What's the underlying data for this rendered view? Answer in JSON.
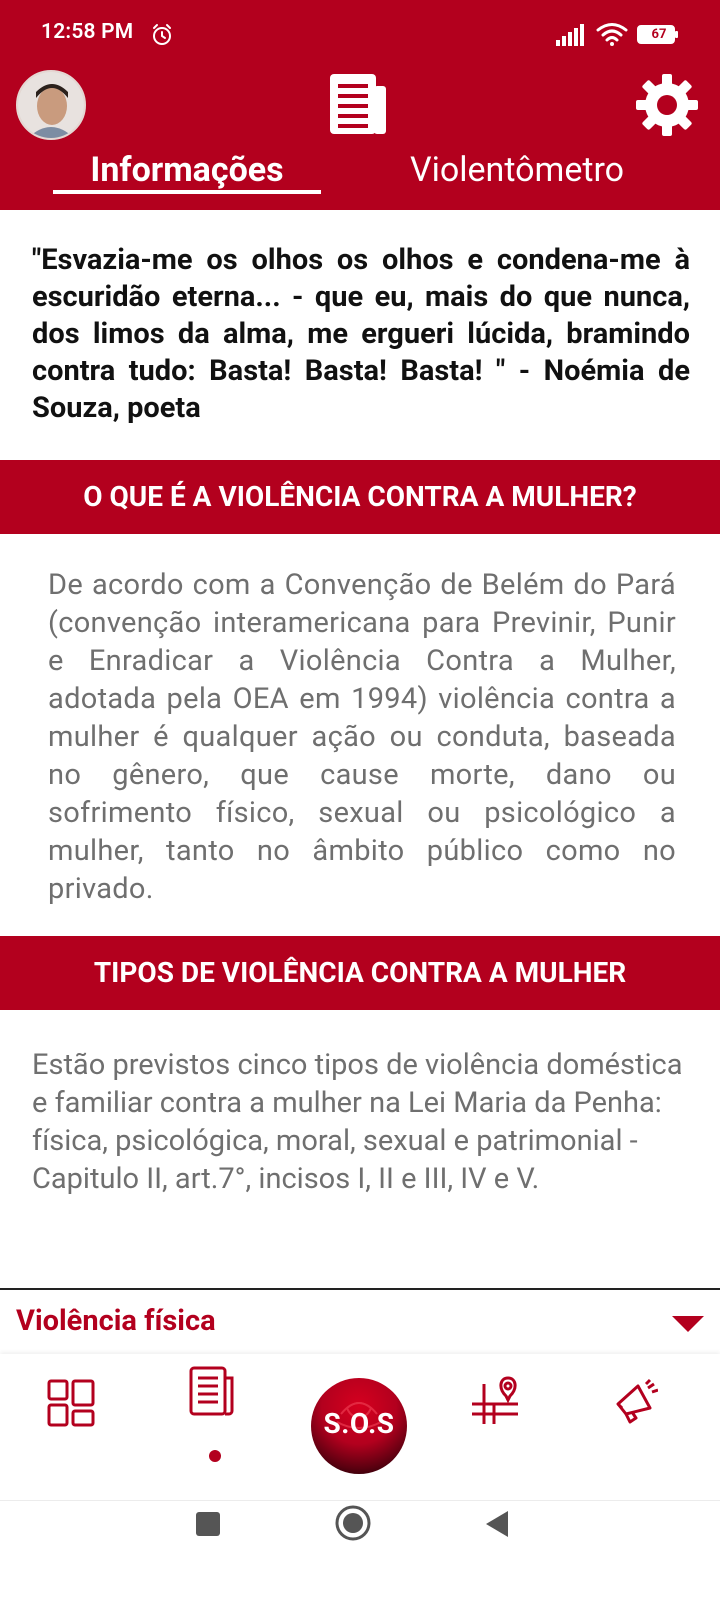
{
  "status_bar": {
    "time": "12:58 PM",
    "battery": "67"
  },
  "header": {
    "tabs": [
      {
        "label": "Informações",
        "active": true
      },
      {
        "label": "Violentômetro",
        "active": false
      }
    ]
  },
  "quote": "\"Esvazia-me os olhos os olhos e condena-me à escuridão eterna... - que eu, mais do que nunca, dos limos da alma, me ergueri lúcida, bramindo contra tudo: Basta! Basta! Basta! \" - Noémia de Souza, poeta",
  "sections": [
    {
      "title": "O QUE É A VIOLÊNCIA CONTRA A MULHER?",
      "body": "De acordo com a Convenção de Belém do Pará (convenção interamericana para Previnir, Punir e Enradicar a Violência Contra a Mulher, adotada pela OEA em 1994) violência contra a mulher é qualquer ação ou conduta, baseada no gênero, que cause morte, dano ou sofrimento físico, sexual ou psicológico a mulher, tanto no âmbito público como no privado."
    },
    {
      "title": "TIPOS DE VIOLÊNCIA CONTRA A MULHER",
      "body": "Estão previstos cinco tipos de violência doméstica e familiar contra a mulher na Lei Maria da Penha: física, psicológica, moral, sexual e patrimonial - Capitulo II, art.7°, incisos I, II e III, IV e V."
    }
  ],
  "accordion": {
    "label": "Violência física"
  },
  "bottom_nav": {
    "items": [
      "dashboard-icon",
      "news-icon",
      "sos-button",
      "map-pin-icon",
      "megaphone-icon"
    ],
    "sos_label": "S.O.S",
    "active_index": 1
  },
  "colors": {
    "brand": "#b3001e",
    "body_text": "#6f6f6f"
  }
}
